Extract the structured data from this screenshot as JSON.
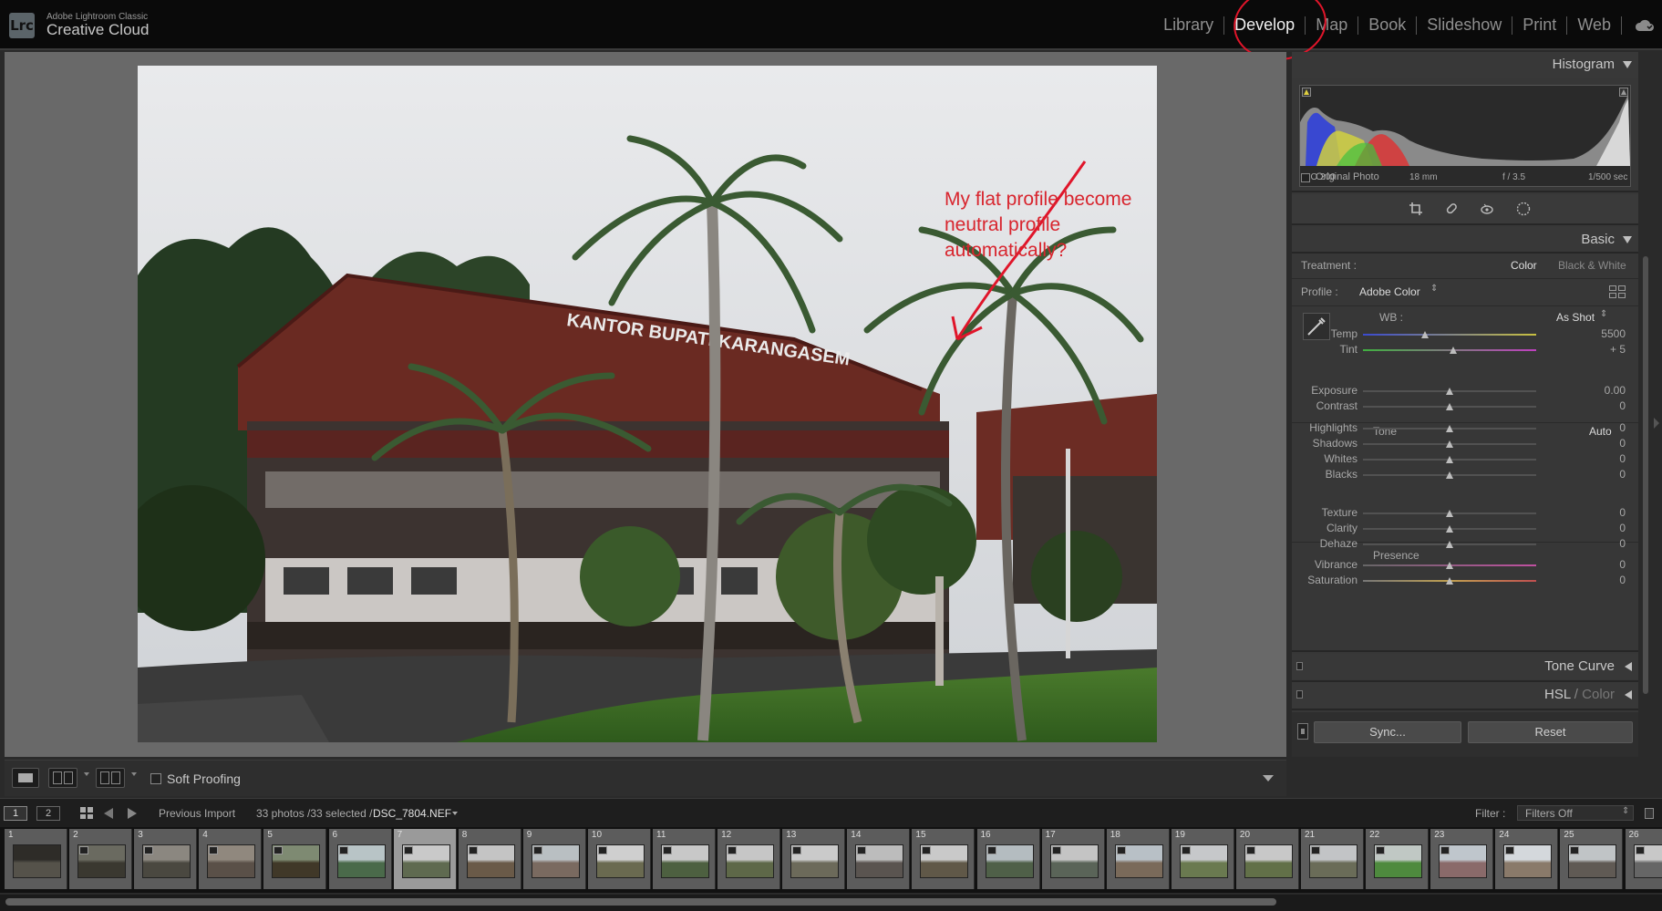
{
  "app": {
    "brand_top": "Adobe Lightroom Classic",
    "brand_main": "Creative Cloud",
    "logo": "Lrc"
  },
  "modules": [
    "Library",
    "Develop",
    "Map",
    "Book",
    "Slideshow",
    "Print",
    "Web"
  ],
  "active_module": "Develop",
  "annotation": {
    "text": "My flat profile become\nneutral profile\nautomatically?",
    "color": "#d8252e"
  },
  "photo": {
    "sign_text": "KANTOR BUPATI KARANGASEM"
  },
  "toolbar": {
    "soft_proofing": "Soft Proofing"
  },
  "histogram": {
    "title": "Histogram",
    "iso": "ISO 200",
    "focal": "18 mm",
    "aperture": "f / 3.5",
    "shutter": "1/500 sec",
    "original_photo": "Original Photo"
  },
  "basic": {
    "title": "Basic",
    "treatment_label": "Treatment :",
    "treatment_color": "Color",
    "treatment_bw": "Black & White",
    "profile_label": "Profile :",
    "profile_value": "Adobe Color",
    "wb_label": "WB :",
    "wb_value": "As Shot",
    "temp": {
      "label": "Temp",
      "value": "5500",
      "pos": 0.36
    },
    "tint": {
      "label": "Tint",
      "value": "+ 5",
      "pos": 0.52
    },
    "tone_label": "Tone",
    "auto_label": "Auto",
    "tone_sliders": [
      {
        "label": "Exposure",
        "value": "0.00"
      },
      {
        "label": "Contrast",
        "value": "0"
      },
      {
        "label": "Highlights",
        "value": "0"
      },
      {
        "label": "Shadows",
        "value": "0"
      },
      {
        "label": "Whites",
        "value": "0"
      },
      {
        "label": "Blacks",
        "value": "0"
      }
    ],
    "presence_label": "Presence",
    "presence_sliders": [
      {
        "label": "Texture",
        "value": "0"
      },
      {
        "label": "Clarity",
        "value": "0"
      },
      {
        "label": "Dehaze",
        "value": "0"
      },
      {
        "label": "Vibrance",
        "value": "0"
      },
      {
        "label": "Saturation",
        "value": "0"
      }
    ]
  },
  "panels": {
    "tone_curve": "Tone Curve",
    "hsl": "HSL",
    "hsl_sep": " / ",
    "hsl_color": "Color"
  },
  "buttons": {
    "sync": "Sync...",
    "reset": "Reset"
  },
  "bottom": {
    "view1": "1",
    "view2": "2",
    "source": "Previous Import",
    "count": "33 photos /33 selected /",
    "filename": "DSC_7804.NEF",
    "filter_label": "Filter :",
    "filter_value": "Filters Off"
  },
  "filmstrip": {
    "numbers": [
      "1",
      "2",
      "3",
      "4",
      "5",
      "6",
      "7",
      "8",
      "9",
      "10",
      "11",
      "12",
      "13",
      "14",
      "15",
      "16",
      "17",
      "18",
      "19",
      "20",
      "21",
      "22",
      "23",
      "24",
      "25",
      "26"
    ],
    "active_index": 6,
    "thumb_colors": [
      [
        "#2e2c28",
        "#55524a"
      ],
      [
        "#6a6a60",
        "#3a3830"
      ],
      [
        "#8b8780",
        "#4a4840"
      ],
      [
        "#90887e",
        "#5a5048"
      ],
      [
        "#7e8a72",
        "#403828"
      ],
      [
        "#b8c4c6",
        "#4a6a4a"
      ],
      [
        "#c9c9c9",
        "#5f6a50"
      ],
      [
        "#c4c4c4",
        "#6a5a48"
      ],
      [
        "#b9bfc2",
        "#7a6a60"
      ],
      [
        "#cfcfcf",
        "#6a6a50"
      ],
      [
        "#c8c8c8",
        "#4d6040"
      ],
      [
        "#c6c6c6",
        "#5e6848"
      ],
      [
        "#cacaca",
        "#6c6a5a"
      ],
      [
        "#bcbcbc",
        "#5a5450"
      ],
      [
        "#c9c9c9",
        "#605848"
      ],
      [
        "#b4bcc0",
        "#4f6048"
      ],
      [
        "#c4c4c4",
        "#5a6458"
      ],
      [
        "#b8c0c6",
        "#7a6a5a"
      ],
      [
        "#c6c8ca",
        "#6a7a50"
      ],
      [
        "#c8c8c8",
        "#627048"
      ],
      [
        "#c2c4c6",
        "#6a6c58"
      ],
      [
        "#c0c8c4",
        "#4e8a3e"
      ],
      [
        "#bfc6cc",
        "#8a6a6a"
      ],
      [
        "#d4d8dc",
        "#8a7a6a"
      ],
      [
        "#c0c4c6",
        "#605a54"
      ],
      [
        "#c8c8c8",
        "#666"
      ]
    ]
  }
}
